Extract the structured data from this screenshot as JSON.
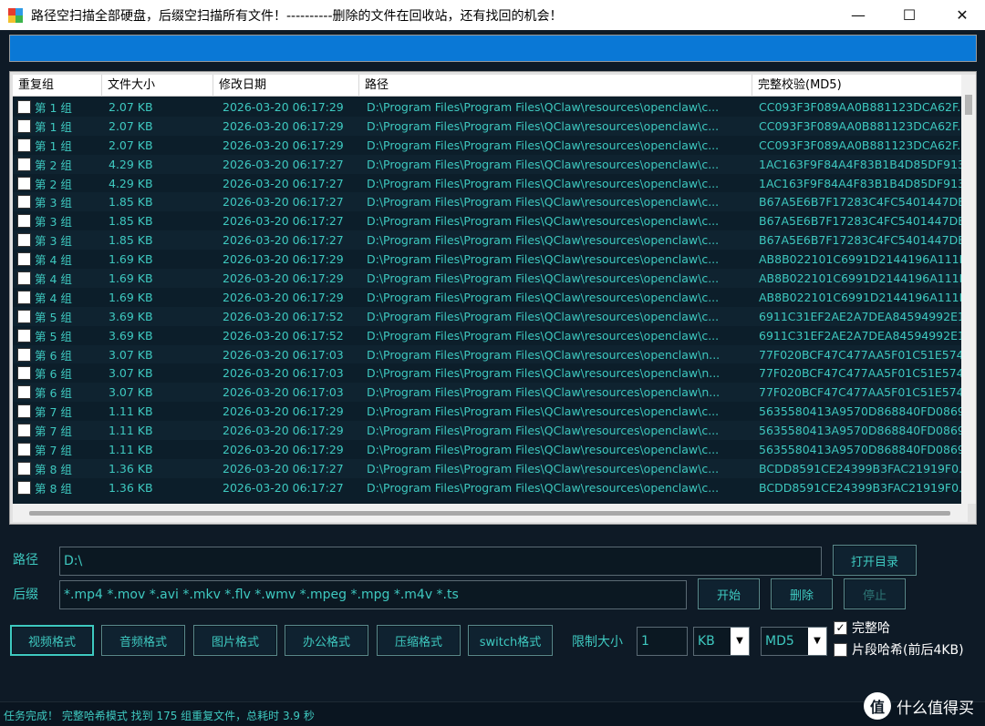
{
  "window": {
    "title": "路径空扫描全部硬盘，后缀空扫描所有文件！----------删除的文件在回收站，还有找回的机会！",
    "minimize": "—",
    "maximize": "☐",
    "close": "✕"
  },
  "progress": {
    "fraction": 1.0,
    "color": "#0a78d6"
  },
  "table": {
    "columns": [
      "重复组",
      "文件大小",
      "修改日期",
      "路径",
      "完整校验(MD5)"
    ],
    "rows": [
      {
        "group": "第 1 组",
        "size": "2.07 KB",
        "date": "2026-03-20 06:17:29",
        "path": "D:\\Program Files\\Program Files\\QClaw\\resources\\openclaw\\c...",
        "md5": "CC093F3F089AA0B881123DCA62F..."
      },
      {
        "group": "第 1 组",
        "size": "2.07 KB",
        "date": "2026-03-20 06:17:29",
        "path": "D:\\Program Files\\Program Files\\QClaw\\resources\\openclaw\\c...",
        "md5": "CC093F3F089AA0B881123DCA62F..."
      },
      {
        "group": "第 1 组",
        "size": "2.07 KB",
        "date": "2026-03-20 06:17:29",
        "path": "D:\\Program Files\\Program Files\\QClaw\\resources\\openclaw\\c...",
        "md5": "CC093F3F089AA0B881123DCA62F..."
      },
      {
        "group": "第 2 组",
        "size": "4.29 KB",
        "date": "2026-03-20 06:17:27",
        "path": "D:\\Program Files\\Program Files\\QClaw\\resources\\openclaw\\c...",
        "md5": "1AC163F9F84A4F83B1B4D85DF913"
      },
      {
        "group": "第 2 组",
        "size": "4.29 KB",
        "date": "2026-03-20 06:17:27",
        "path": "D:\\Program Files\\Program Files\\QClaw\\resources\\openclaw\\c...",
        "md5": "1AC163F9F84A4F83B1B4D85DF913"
      },
      {
        "group": "第 3 组",
        "size": "1.85 KB",
        "date": "2026-03-20 06:17:27",
        "path": "D:\\Program Files\\Program Files\\QClaw\\resources\\openclaw\\c...",
        "md5": "B67A5E6B7F17283C4FC5401447DE"
      },
      {
        "group": "第 3 组",
        "size": "1.85 KB",
        "date": "2026-03-20 06:17:27",
        "path": "D:\\Program Files\\Program Files\\QClaw\\resources\\openclaw\\c...",
        "md5": "B67A5E6B7F17283C4FC5401447DE"
      },
      {
        "group": "第 3 组",
        "size": "1.85 KB",
        "date": "2026-03-20 06:17:27",
        "path": "D:\\Program Files\\Program Files\\QClaw\\resources\\openclaw\\c...",
        "md5": "B67A5E6B7F17283C4FC5401447DE"
      },
      {
        "group": "第 4 组",
        "size": "1.69 KB",
        "date": "2026-03-20 06:17:29",
        "path": "D:\\Program Files\\Program Files\\QClaw\\resources\\openclaw\\c...",
        "md5": "AB8B022101C6991D2144196A111E"
      },
      {
        "group": "第 4 组",
        "size": "1.69 KB",
        "date": "2026-03-20 06:17:29",
        "path": "D:\\Program Files\\Program Files\\QClaw\\resources\\openclaw\\c...",
        "md5": "AB8B022101C6991D2144196A111E"
      },
      {
        "group": "第 4 组",
        "size": "1.69 KB",
        "date": "2026-03-20 06:17:29",
        "path": "D:\\Program Files\\Program Files\\QClaw\\resources\\openclaw\\c...",
        "md5": "AB8B022101C6991D2144196A111E"
      },
      {
        "group": "第 5 组",
        "size": "3.69 KB",
        "date": "2026-03-20 06:17:52",
        "path": "D:\\Program Files\\Program Files\\QClaw\\resources\\openclaw\\c...",
        "md5": "6911C31EF2AE2A7DEA84594992E1"
      },
      {
        "group": "第 5 组",
        "size": "3.69 KB",
        "date": "2026-03-20 06:17:52",
        "path": "D:\\Program Files\\Program Files\\QClaw\\resources\\openclaw\\c...",
        "md5": "6911C31EF2AE2A7DEA84594992E1"
      },
      {
        "group": "第 6 组",
        "size": "3.07 KB",
        "date": "2026-03-20 06:17:03",
        "path": "D:\\Program Files\\Program Files\\QClaw\\resources\\openclaw\\n...",
        "md5": "77F020BCF47C477AA5F01C51E574"
      },
      {
        "group": "第 6 组",
        "size": "3.07 KB",
        "date": "2026-03-20 06:17:03",
        "path": "D:\\Program Files\\Program Files\\QClaw\\resources\\openclaw\\n...",
        "md5": "77F020BCF47C477AA5F01C51E574"
      },
      {
        "group": "第 6 组",
        "size": "3.07 KB",
        "date": "2026-03-20 06:17:03",
        "path": "D:\\Program Files\\Program Files\\QClaw\\resources\\openclaw\\n...",
        "md5": "77F020BCF47C477AA5F01C51E574"
      },
      {
        "group": "第 7 组",
        "size": "1.11 KB",
        "date": "2026-03-20 06:17:29",
        "path": "D:\\Program Files\\Program Files\\QClaw\\resources\\openclaw\\c...",
        "md5": "5635580413A9570D868840FD0869..."
      },
      {
        "group": "第 7 组",
        "size": "1.11 KB",
        "date": "2026-03-20 06:17:29",
        "path": "D:\\Program Files\\Program Files\\QClaw\\resources\\openclaw\\c...",
        "md5": "5635580413A9570D868840FD0869..."
      },
      {
        "group": "第 7 组",
        "size": "1.11 KB",
        "date": "2026-03-20 06:17:29",
        "path": "D:\\Program Files\\Program Files\\QClaw\\resources\\openclaw\\c...",
        "md5": "5635580413A9570D868840FD0869..."
      },
      {
        "group": "第 8 组",
        "size": "1.36 KB",
        "date": "2026-03-20 06:17:27",
        "path": "D:\\Program Files\\Program Files\\QClaw\\resources\\openclaw\\c...",
        "md5": "BCDD8591CE24399B3FAC21919F0..."
      },
      {
        "group": "第 8 组",
        "size": "1.36 KB",
        "date": "2026-03-20 06:17:27",
        "path": "D:\\Program Files\\Program Files\\QClaw\\resources\\openclaw\\c...",
        "md5": "BCDD8591CE24399B3FAC21919F0..."
      }
    ]
  },
  "form": {
    "path_label": "路径",
    "path_value": "D:\\",
    "suffix_label": "后缀",
    "suffix_value": "*.mp4 *.mov *.avi *.mkv *.flv *.wmv *.mpeg *.mpg *.m4v *.ts",
    "open_dir": "打开目录",
    "start": "开始",
    "delete": "删除",
    "stop": "停止",
    "formats": [
      "视频格式",
      "音频格式",
      "图片格式",
      "办公格式",
      "压缩格式",
      "switch格式"
    ],
    "limit_label": "限制大小",
    "limit_value": "1",
    "unit_value": "KB",
    "hash_value": "MD5",
    "full_hash_label": "完整哈",
    "full_hash_checked": true,
    "partial_hash_label": "片段哈希(前后4KB)",
    "partial_hash_checked": false
  },
  "status": {
    "text": "任务完成！ 完整哈希模式 找到 175 组重复文件，总耗时 3.9 秒"
  },
  "watermark": {
    "logo": "值",
    "text": "什么值得买"
  },
  "colors": {
    "accent": "#3ec9c0",
    "background": "#0e1a26"
  }
}
